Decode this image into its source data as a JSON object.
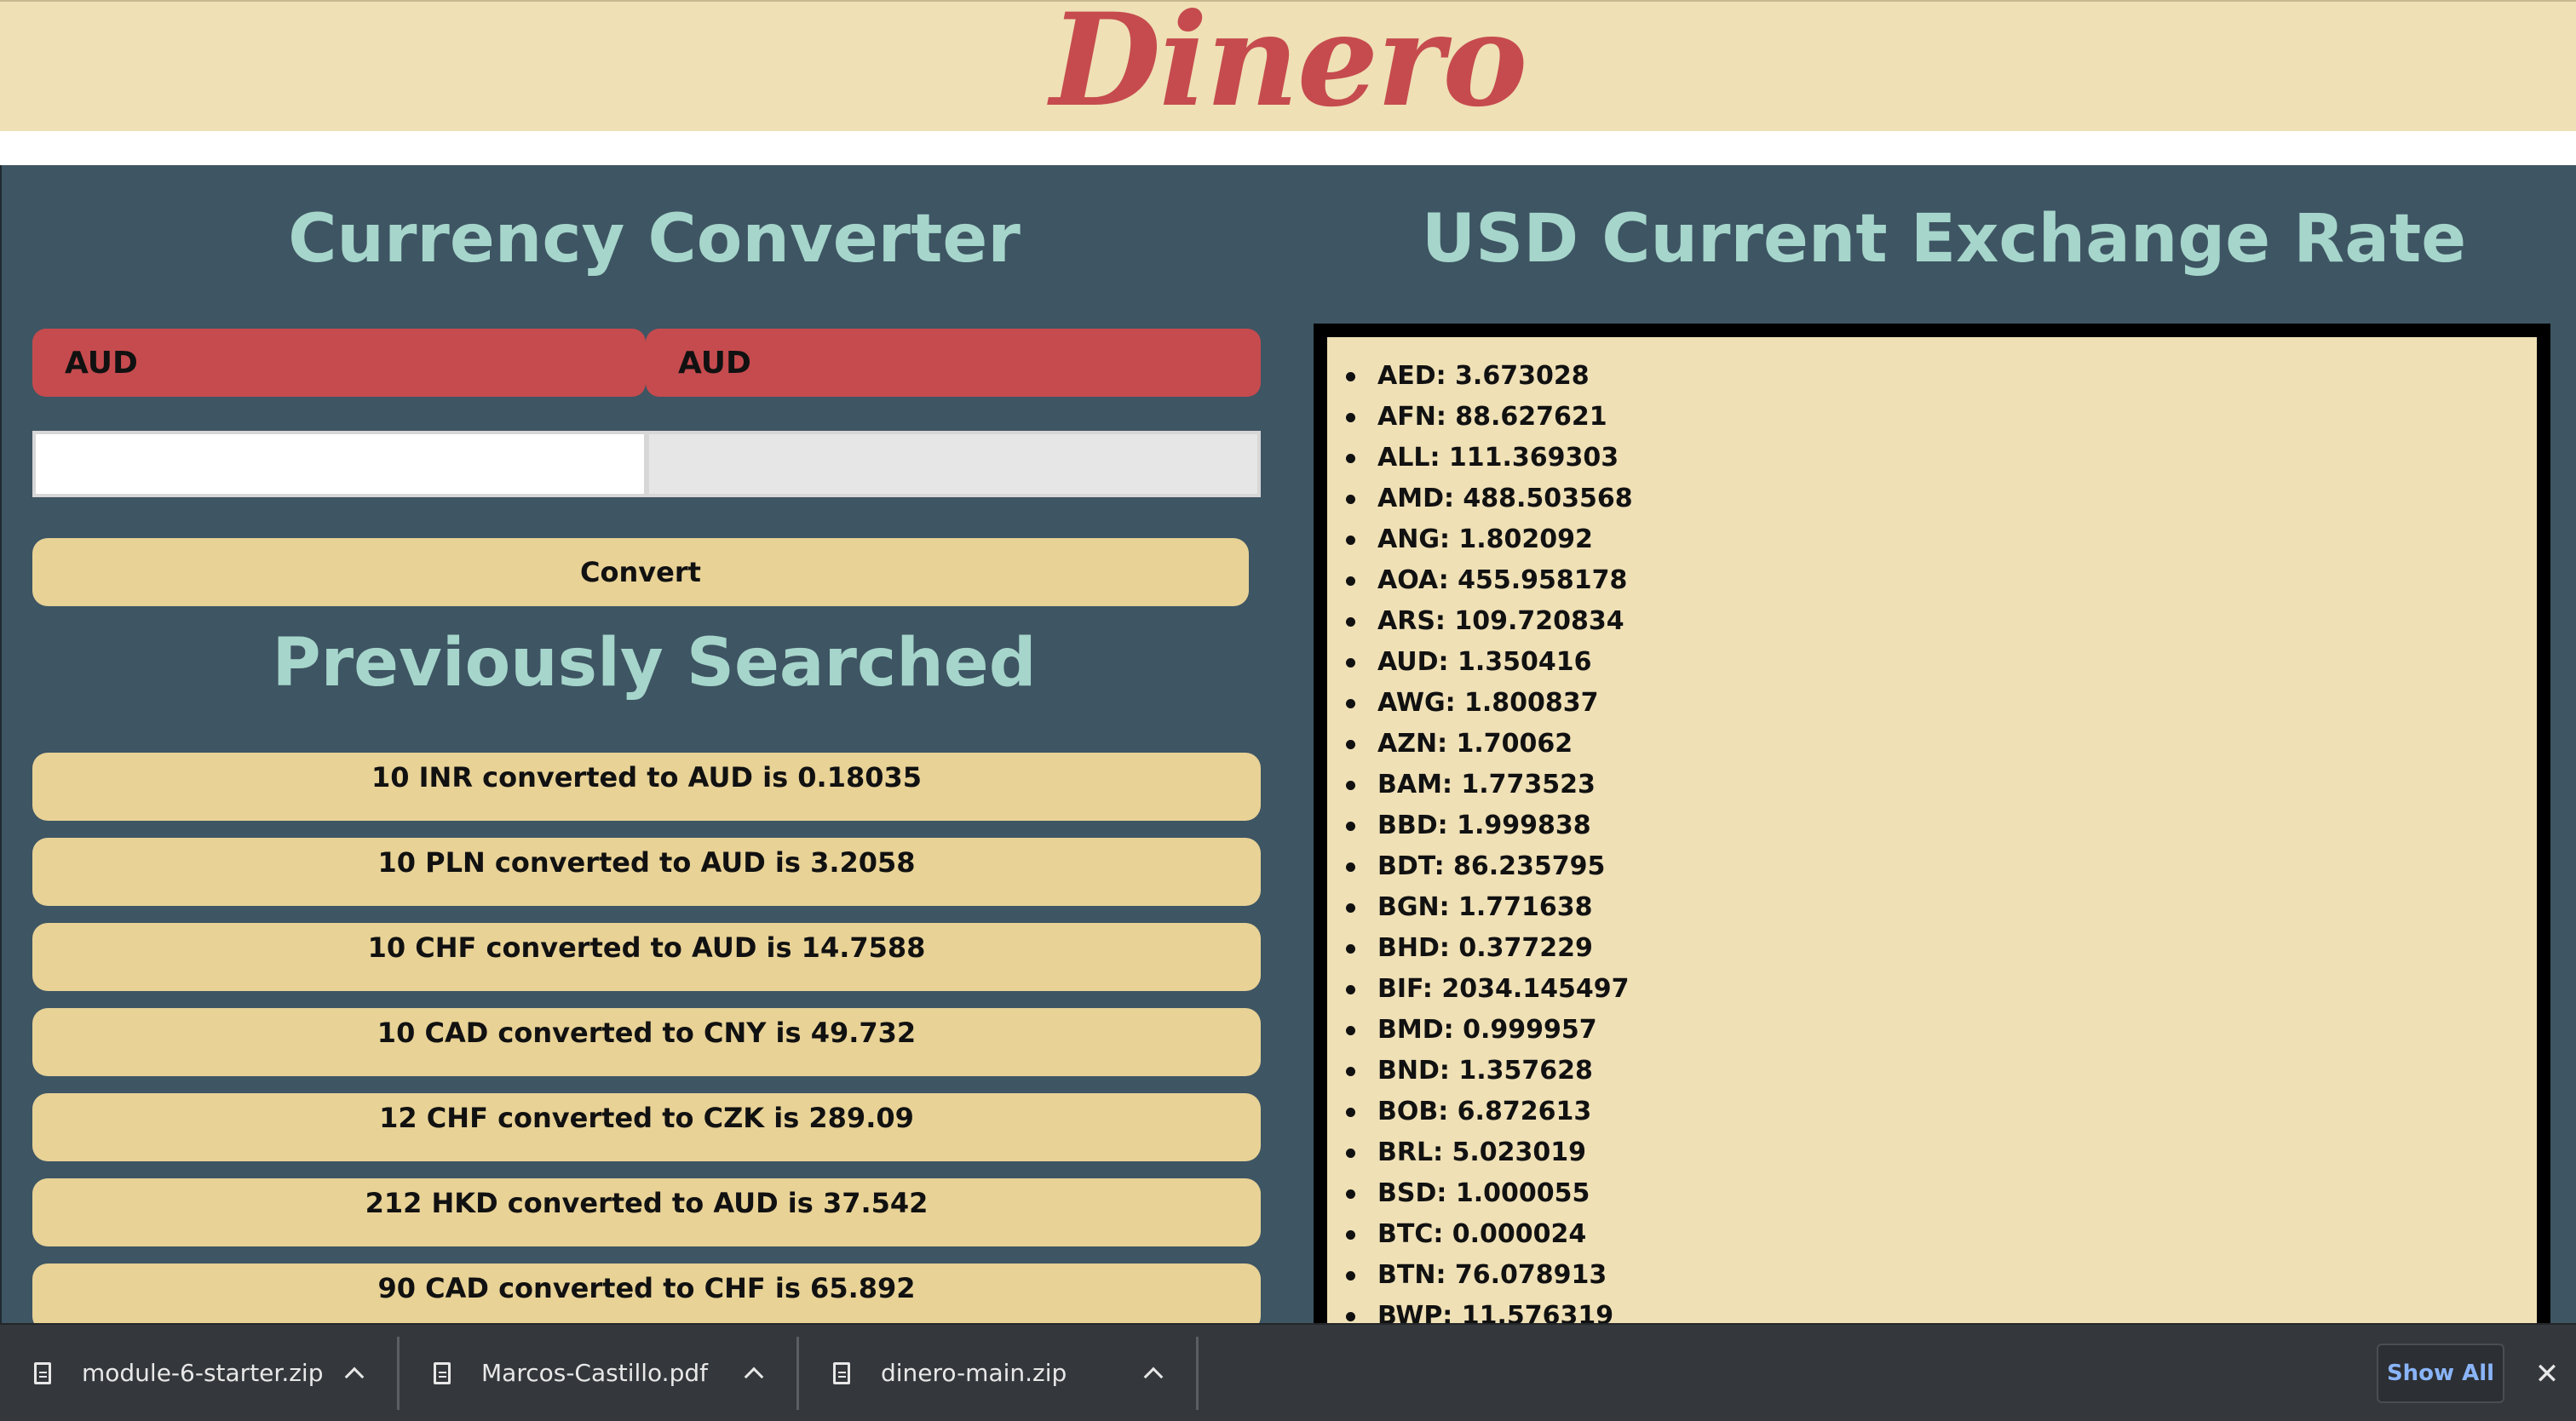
{
  "header": {
    "logo": "Dinero"
  },
  "converter": {
    "title": "Currency Converter",
    "from_currency": "AUD",
    "to_currency": "AUD",
    "from_value": "",
    "to_value": "",
    "convert_label": "Convert"
  },
  "history": {
    "title": "Previously Searched",
    "items": [
      "10 INR converted to AUD is 0.18035",
      "10 PLN converted to AUD is 3.2058",
      "10 CHF converted to AUD is 14.7588",
      "10 CAD converted to CNY is 49.732",
      "12 CHF converted to CZK is 289.09",
      "212 HKD converted to AUD is 37.542",
      "90 CAD converted to CHF is 65.892"
    ]
  },
  "rates": {
    "title": "USD Current Exchange Rate",
    "items": [
      "AED: 3.673028",
      "AFN: 88.627621",
      "ALL: 111.369303",
      "AMD: 488.503568",
      "ANG: 1.802092",
      "AOA: 455.958178",
      "ARS: 109.720834",
      "AUD: 1.350416",
      "AWG: 1.800837",
      "AZN: 1.70062",
      "BAM: 1.773523",
      "BBD: 1.999838",
      "BDT: 86.235795",
      "BGN: 1.771638",
      "BHD: 0.377229",
      "BIF: 2034.145497",
      "BMD: 0.999957",
      "BND: 1.357628",
      "BOB: 6.872613",
      "BRL: 5.023019",
      "BSD: 1.000055",
      "BTC: 0.000024",
      "BTN: 76.078913",
      "BWP: 11.576319"
    ]
  },
  "downloads": {
    "items": [
      {
        "name": "module-6-starter.zip"
      },
      {
        "name": "Marcos-Castillo.pdf"
      },
      {
        "name": "dinero-main.zip"
      }
    ],
    "show_all_label": "Show All",
    "close_glyph": "✕"
  }
}
